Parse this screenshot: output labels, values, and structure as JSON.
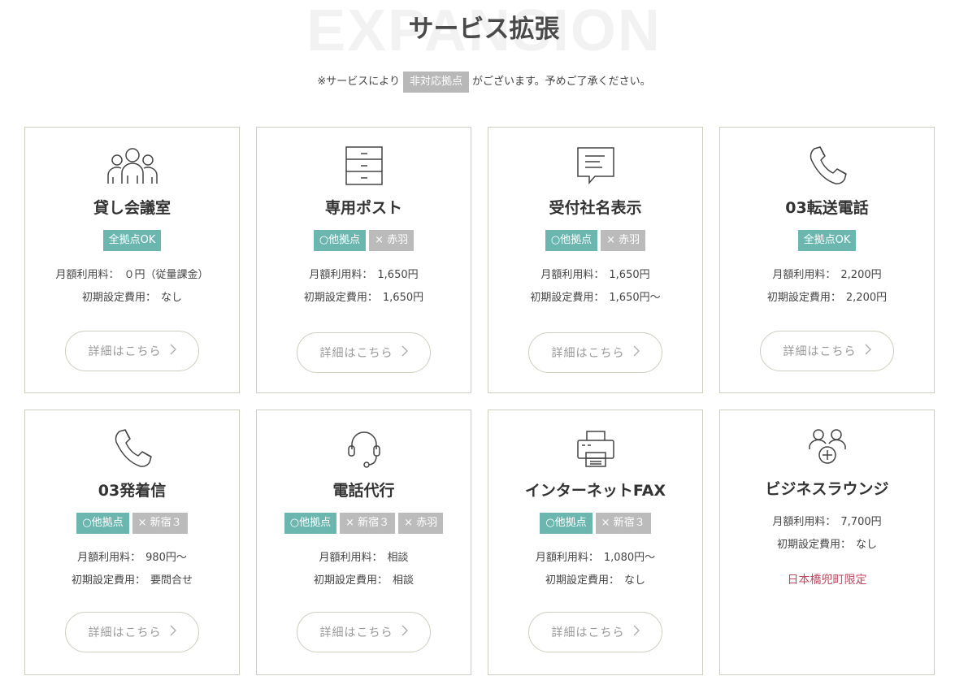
{
  "background_word": "EXPANSION",
  "title": "サービス拡張",
  "notice": {
    "prefix": "※サービスにより",
    "chip": "非対応拠点",
    "suffix": "がございます。予めご了承ください。"
  },
  "colors": {
    "badge_ok": "#6cb6b0",
    "badge_ng": "#bbbbbb",
    "limit_text": "#c0475e",
    "card_border": "#cfcdbd"
  },
  "fee_labels": {
    "monthly": "月額利用料：",
    "initial": "初期設定費用："
  },
  "detail_button_label": "詳細はこちら",
  "services": [
    {
      "icon": "people-icon",
      "name": "貸し会議室",
      "badges": [
        {
          "text": "全拠点OK",
          "type": "ok"
        }
      ],
      "monthly": "０円（従量課金）",
      "initial": "なし"
    },
    {
      "icon": "cabinet-icon",
      "name": "専用ポスト",
      "badges": [
        {
          "text": "○他拠点",
          "type": "ok"
        },
        {
          "text": "× 赤羽",
          "type": "ng"
        }
      ],
      "monthly": "1,650円",
      "initial": "1,650円"
    },
    {
      "icon": "message-icon",
      "name": "受付社名表示",
      "badges": [
        {
          "text": "○他拠点",
          "type": "ok"
        },
        {
          "text": "× 赤羽",
          "type": "ng"
        }
      ],
      "monthly": "1,650円",
      "initial": "1,650円～"
    },
    {
      "icon": "phone-icon",
      "name": "03転送電話",
      "badges": [
        {
          "text": "全拠点OK",
          "type": "ok"
        }
      ],
      "monthly": "2,200円",
      "initial": "2,200円"
    },
    {
      "icon": "phone-icon",
      "name": "03発着信",
      "badges": [
        {
          "text": "○他拠点",
          "type": "ok"
        },
        {
          "text": "× 新宿３",
          "type": "ng"
        }
      ],
      "monthly": "980円～",
      "initial": "要問合せ"
    },
    {
      "icon": "headset-icon",
      "name": "電話代行",
      "badges": [
        {
          "text": "○他拠点",
          "type": "ok"
        },
        {
          "text": "× 新宿３",
          "type": "ng"
        },
        {
          "text": "× 赤羽",
          "type": "ng"
        }
      ],
      "monthly": "相談",
      "initial": "相談"
    },
    {
      "icon": "fax-icon",
      "name": "インターネットFAX",
      "badges": [
        {
          "text": "○他拠点",
          "type": "ok"
        },
        {
          "text": "× 新宿３",
          "type": "ng"
        }
      ],
      "monthly": "1,080円～",
      "initial": "なし"
    },
    {
      "icon": "add-user-icon",
      "name": "ビジネスラウンジ",
      "badges": [],
      "monthly": "7,700円",
      "initial": "なし",
      "limit": "日本橋兜町限定"
    }
  ]
}
